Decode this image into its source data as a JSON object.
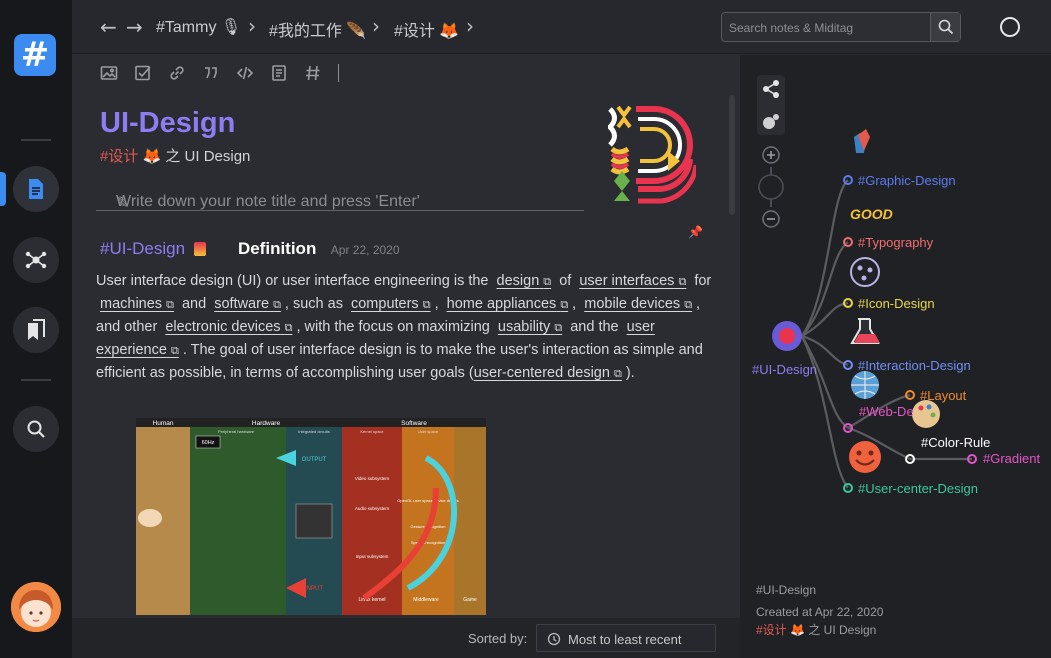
{
  "breadcrumb": [
    {
      "label": "#Tammy 🎙"
    },
    {
      "label": "#我的工作 🪶"
    },
    {
      "label": "#设计 🦊"
    }
  ],
  "search": {
    "placeholder": "Search notes & Miditag"
  },
  "note": {
    "title": "UI-Design",
    "parent_tag": "#设计",
    "parent_emoji": "🦊",
    "zhi": "之 UI Design",
    "title_placeholder": "Write down your note title and press 'Enter'"
  },
  "block": {
    "tag": "#UI-Design",
    "title": "Definition",
    "date": "Apr 22, 2020",
    "text": {
      "p1": "User interface design (UI) or user interface engineering is the",
      "link_design": "design",
      "p2": "of",
      "link_user_interfaces": "user interfaces",
      "p3": "for",
      "link_machines": "machines",
      "p4": "and",
      "link_software": "software",
      "p5": ", such as",
      "link_computers": "computers",
      "p6": ",",
      "link_home_appliances": "home appliances",
      "p7": ",",
      "link_mobile_devices": "mobile devices",
      "p8": ", and other",
      "link_electronic_devices": "electronic devices",
      "p9": ", with the focus on maximizing",
      "link_usability": "usability",
      "p10": "and the",
      "link_user_experience": "user experience",
      "p11": ". The goal of user interface design is to make the user's interaction as simple and efficient as possible, in terms of accomplishing user goals (",
      "link_user_centered": "user-centered design",
      "p12": ")."
    },
    "diagram": {
      "human": "Human",
      "hardware": "Hardware",
      "software": "Software",
      "peripheral": "Peripheral hardware",
      "integrated": "Integrated circuits",
      "kernel_space": "Kernel space",
      "user_space": "User space",
      "output": "OUTPUT",
      "input": "INPUT",
      "video": "Video subsystem",
      "audio": "Audio subsystem",
      "input_sub": "Input subsystem",
      "linux": "Linux kernel",
      "middleware": "Middleware",
      "game": "Game",
      "gesture": "Gesture recognition",
      "speech": "Speech recognition",
      "hz": "60Hz",
      "opengl": "OpenGL user space device drivers"
    }
  },
  "sort": {
    "label": "Sorted by:",
    "value": "Most to least recent"
  },
  "graph": {
    "center": "#UI-Design",
    "nodes": [
      {
        "label": "#Graphic-Design",
        "color": "#5b7cf0"
      },
      {
        "label": "#Typography",
        "color": "#f26d6d"
      },
      {
        "label": "#Icon-Design",
        "color": "#e8d64a"
      },
      {
        "label": "#Interaction-Design",
        "color": "#6f8ff5"
      },
      {
        "label": "#Web-De",
        "color": "#e455c8"
      },
      {
        "label": "#Layout",
        "color": "#f08a2a"
      },
      {
        "label": "#Color-Rule",
        "color": "#ffffff"
      },
      {
        "label": "#Gradient",
        "color": "#e455c8"
      },
      {
        "label": "#User-center-Design",
        "color": "#3ac99a"
      }
    ],
    "good_label": "GOOD",
    "footer_tag": "#UI-Design",
    "created": "Created at Apr 22, 2020",
    "footer_parent": "#设计",
    "footer_emoji": "🦊",
    "footer_zhi": "之 UI Design"
  }
}
